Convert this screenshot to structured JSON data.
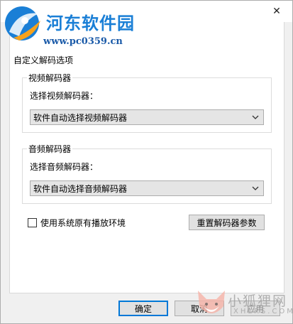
{
  "watermark_top": {
    "title": "河东软件园",
    "url": "www.pc0359.cn"
  },
  "watermark_bottom": {
    "text": "小狐狸网",
    "sub": "XHLRS.COM"
  },
  "titlebar": {
    "close_symbol": "✕"
  },
  "panel": {
    "title": "自定义解码选项"
  },
  "video_group": {
    "label": "视频解码器",
    "field_label": "选择视频解码器：",
    "selected": "软件自动选择视频解码器"
  },
  "audio_group": {
    "label": "音频解码器",
    "field_label": "选择音频解码器：",
    "selected": "软件自动选择音频解码器"
  },
  "options": {
    "use_system_env_label": "使用系统原有播放环境",
    "use_system_env_checked": false,
    "reset_button": "重置解码器参数"
  },
  "footer": {
    "ok": "确定",
    "cancel": "取消",
    "apply": "应用"
  }
}
